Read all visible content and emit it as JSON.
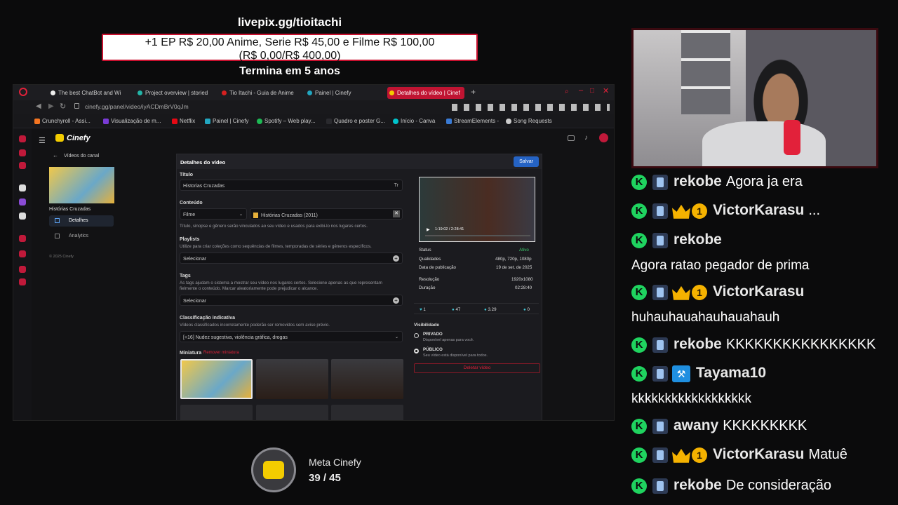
{
  "donation": {
    "url": "livepix.gg/tioitachi",
    "line1": "+1 EP R$ 20,00 Anime, Serie R$ 45,00 e Filme R$ 100,00",
    "line2": "(R$ 0,00/R$ 400,00)",
    "ends": "Termina em 5 anos"
  },
  "browser": {
    "tabs": [
      "The best ChatBot and Wi",
      "Project overview | storied",
      "Tio Itachi - Guia de Anime",
      "Painel | Cinefy",
      "Detalhes do vídeo | Cinef"
    ],
    "url": "cinefy.gg/panel/video/iyACDmBrV0qJm",
    "bookmarks": [
      "Crunchyroll - Assi...",
      "Visualização de m...",
      "Netflix",
      "Painel | Cinefy",
      "Spotify – Web play...",
      "Quadro e poster G...",
      "Início - Canva",
      "StreamElements -",
      "Song Requests"
    ]
  },
  "app": {
    "brand": "Cinefy",
    "back": "Vídeos do canal",
    "video_title": "Histórias Cruzadas",
    "nav": [
      "Detalhes",
      "Analytics"
    ],
    "copyright": "© 2025 Cinefy",
    "panel_title": "Detalhes do vídeo",
    "save": "Salvar",
    "titulo_label": "Título",
    "titulo_value": "Historias Cruzadas",
    "conteudo_label": "Conteúdo",
    "tipo": "Filme",
    "conteudo_value": "Histórias Cruzadas (2011)",
    "conteudo_note": "Título, sinopse e gênero serão vinculados ao seu vídeo e usados para exibi-lo nos lugares certos.",
    "playlists_label": "Playlists",
    "playlists_note": "Utilize para criar coleções como sequências de filmes, temporadas de séries e gêneros específicos.",
    "select": "Selecionar",
    "tags_label": "Tags",
    "tags_note": "As tags ajudam o sistema a mostrar seu vídeo nos lugares certos. Selecione apenas as que representam fielmente o conteúdo. Marcar aleatoriamente pode prejudicar o alcance.",
    "class_label": "Classificação indicativa",
    "class_note": "Vídeos classificados incorretamente poderão ser removidos sem aviso prévio.",
    "class_value": "[+16] Nudez sugestiva, violência gráfica, drogas",
    "miniatura": "Miniatura",
    "remover": "Remover miniatura",
    "time": "1:19:02 / 2:28:41",
    "status_label": "Status",
    "status_value": "Ativo",
    "qual_label": "Qualidades",
    "qual_value": "480p, 720p, 1080p",
    "pub_label": "Data de publicação",
    "pub_value": "19 de set. de 2025",
    "res_label": "Resolução",
    "res_value": "1920x1080",
    "dur_label": "Duração",
    "dur_value": "02:28:40",
    "stats": [
      "1",
      "47",
      "3.29",
      "0"
    ],
    "vis_label": "Visibilidade",
    "privado": "PRIVADO",
    "privado_note": "Disponível apenas para você.",
    "publico": "PÚBLICO",
    "publico_note": "Seu vídeo está disponível para todos.",
    "delete": "Deletar vídeo"
  },
  "chat": [
    {
      "user": "rekobe",
      "text": "Agora ja era"
    },
    {
      "user": "VictorKarasu",
      "text": "...",
      "badge": "crown"
    },
    {
      "user": "rekobe",
      "text": ""
    },
    {
      "full": "Agora ratao pegador de prima"
    },
    {
      "user": "VictorKarasu",
      "text": "",
      "badge": "crown"
    },
    {
      "full": "huhauhauahauhauahauh"
    },
    {
      "user": "rekobe",
      "text": "KKKKKKKKKKKKKKKK"
    },
    {
      "user": "Tayama10",
      "text": "",
      "badge": "hammer"
    },
    {
      "full": "kkkkkkkkkkkkkkkkkk"
    },
    {
      "user": "awany",
      "text": "KKKKKKKKK"
    },
    {
      "user": "VictorKarasu",
      "text": "Matuê",
      "badge": "crown"
    },
    {
      "user": "rekobe",
      "text": "De consideração"
    }
  ],
  "meta": {
    "title": "Meta Cinefy",
    "count": "39 / 45"
  }
}
